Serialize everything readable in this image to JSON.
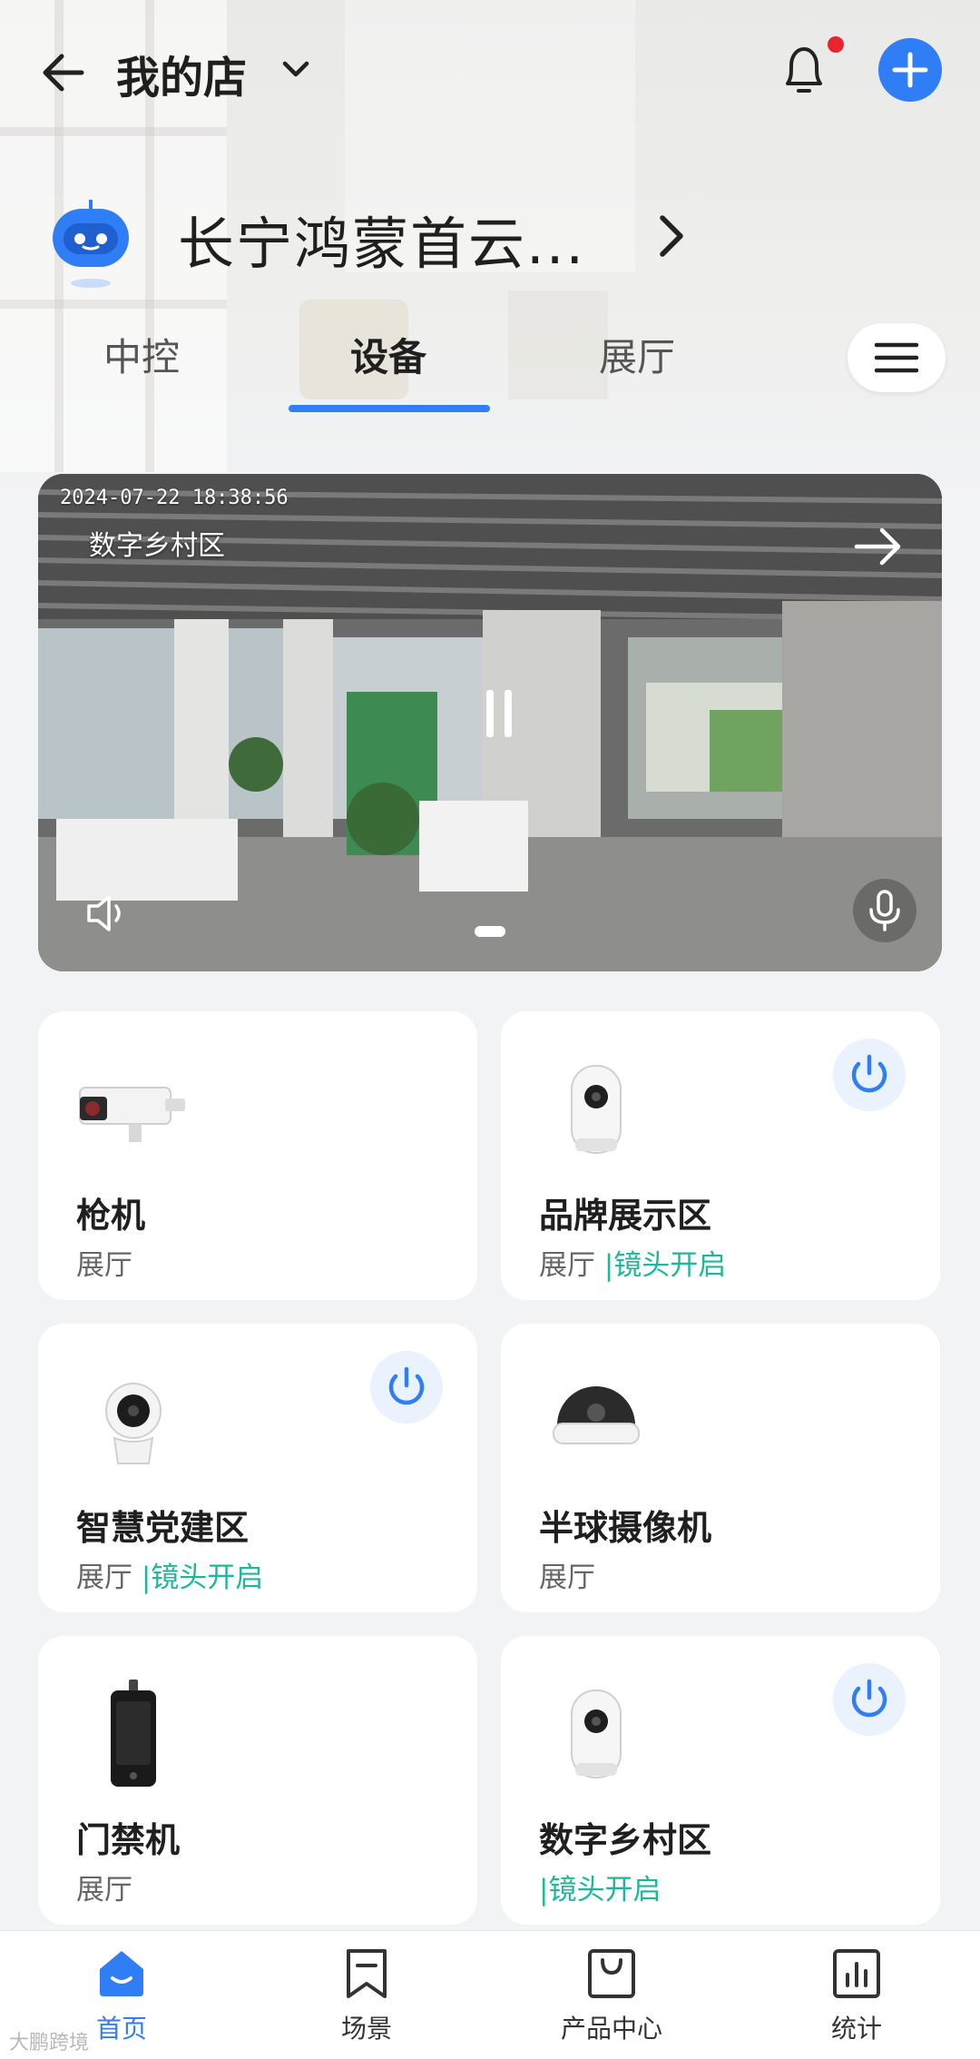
{
  "header": {
    "title": "我的店",
    "space_name": "长宁鸿蒙首云...",
    "notification_badge": true
  },
  "tabs": [
    {
      "label": "中控",
      "active": false
    },
    {
      "label": "设备",
      "active": true
    },
    {
      "label": "展厅",
      "active": false
    }
  ],
  "camera": {
    "timestamp": "2024-07-22 18:38:56",
    "name": "数字乡村区",
    "page_count": 2,
    "active_page": 1
  },
  "devices": [
    {
      "name": "枪机",
      "room": "展厅",
      "status": "",
      "image": "bullet-camera-icon",
      "power_button": false
    },
    {
      "name": "品牌展示区",
      "room": "展厅",
      "status": "|镜头开启",
      "image": "pan-tilt-camera-icon",
      "power_button": true
    },
    {
      "name": "智慧党建区",
      "room": "展厅",
      "status": "|镜头开启",
      "image": "round-camera-icon",
      "power_button": true
    },
    {
      "name": "半球摄像机",
      "room": "展厅",
      "status": "",
      "image": "dome-camera-icon",
      "power_button": false
    },
    {
      "name": "门禁机",
      "room": "展厅",
      "status": "",
      "image": "access-terminal-icon",
      "power_button": false
    },
    {
      "name": "数字乡村区",
      "room": "",
      "status": "|镜头开启",
      "image": "pan-tilt-camera-icon",
      "power_button": true
    }
  ],
  "bottom_nav": [
    {
      "label": "首页",
      "icon": "home-icon",
      "active": true
    },
    {
      "label": "场景",
      "icon": "scene-icon",
      "active": false
    },
    {
      "label": "产品中心",
      "icon": "product-center-icon",
      "active": false
    },
    {
      "label": "统计",
      "icon": "statistics-icon",
      "active": false
    }
  ],
  "watermark": "大鹏跨境",
  "colors": {
    "accent": "#2f7ef6",
    "status_green": "#1db79a",
    "badge_red": "#e8242f",
    "power_bg": "#eaf2fd"
  }
}
